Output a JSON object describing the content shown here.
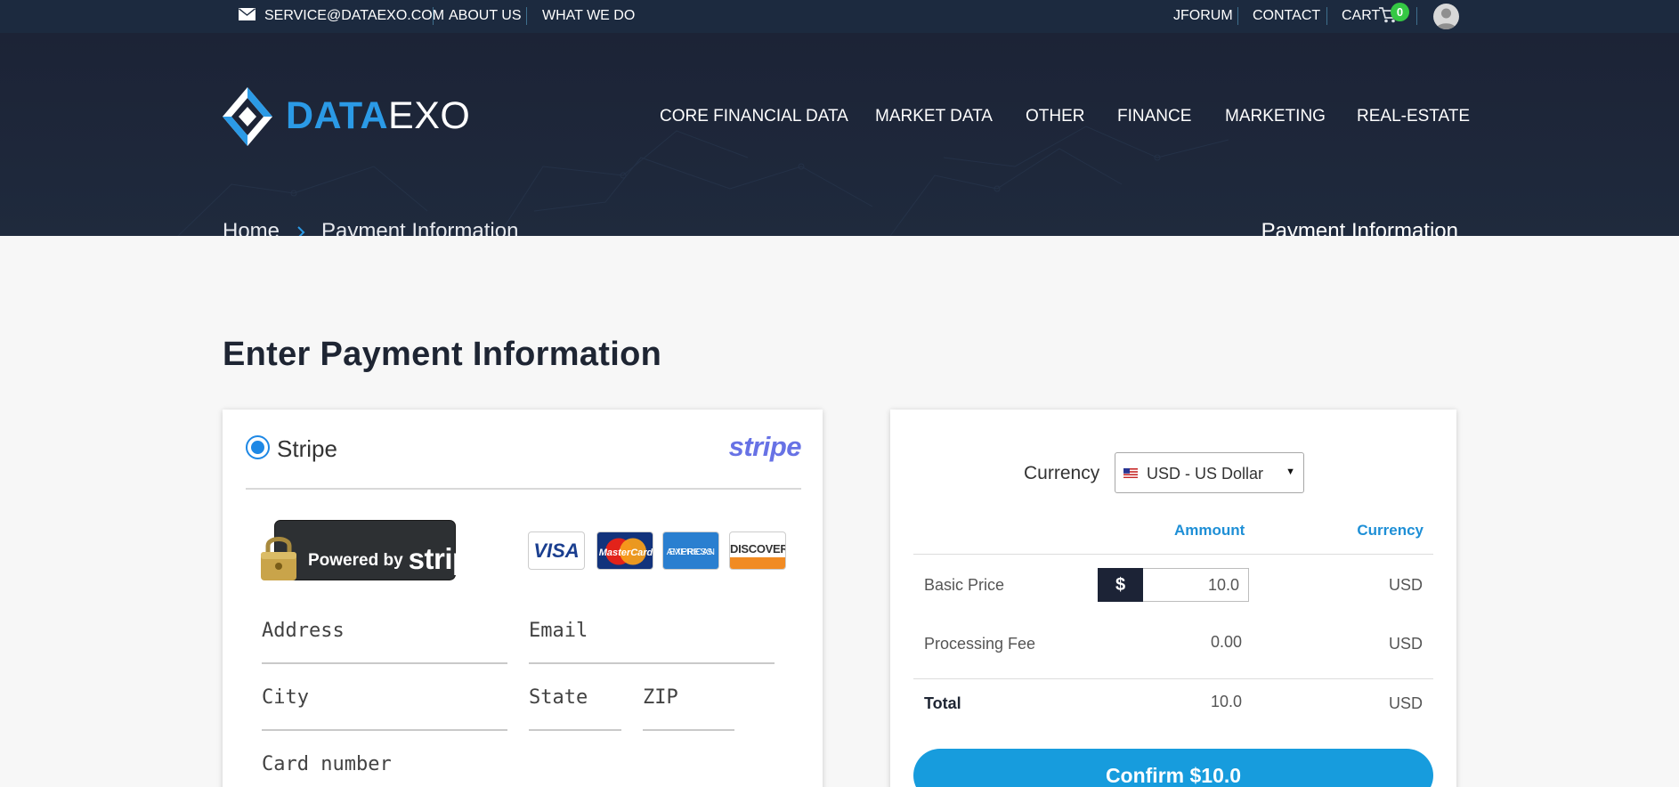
{
  "topbar": {
    "email": "SERVICE@DATAEXO.COM",
    "about": "ABOUT US",
    "what_we_do": "WHAT WE DO",
    "jforum": "JFORUM",
    "contact": "CONTACT",
    "cart": "CART",
    "cart_count": "0",
    "icons": [
      "envelope-icon",
      "cart-icon",
      "user-avatar-icon"
    ]
  },
  "brand": {
    "logo_data": "DATA",
    "logo_exo": "EXO",
    "accent": "#2b9ae6",
    "dark": "#1c2336"
  },
  "nav": {
    "items": [
      {
        "label": "CORE FINANCIAL DATA"
      },
      {
        "label": "MARKET DATA"
      },
      {
        "label": "OTHER"
      },
      {
        "label": "FINANCE"
      },
      {
        "label": "MARKETING"
      },
      {
        "label": "REAL-ESTATE"
      }
    ]
  },
  "breadcrumb": {
    "home": "Home",
    "current": "Payment Information"
  },
  "hero_title": "Payment Information",
  "page_title": "Enter Payment Information",
  "payment": {
    "method_label": "Stripe",
    "stripe_wordmark": "stripe",
    "powered_by": "Powered by",
    "powered_by_brand": "stripe",
    "cards": {
      "visa": "VISA",
      "mastercard": "MasterCard",
      "amex_line1": "AMERICAN",
      "amex_line2": "EXPRESS",
      "discover": "DISCOVER"
    },
    "fields": {
      "address": "Address",
      "email": "Email",
      "city": "City",
      "state": "State",
      "zip": "ZIP",
      "card_number": "Card number"
    }
  },
  "summary": {
    "currency_label": "Currency",
    "currency_value": "USD - US Dollar",
    "headers": {
      "amount": "Ammount",
      "currency": "Currency"
    },
    "rows": [
      {
        "label": "Basic Price",
        "symbol": "$",
        "amount": "10.0",
        "currency": "USD"
      },
      {
        "label": "Processing Fee",
        "amount": "0.00",
        "currency": "USD"
      },
      {
        "label": "Total",
        "amount": "10.0",
        "currency": "USD"
      }
    ],
    "confirm_label": "Confirm $10.0",
    "button_color": "#179cdd"
  }
}
